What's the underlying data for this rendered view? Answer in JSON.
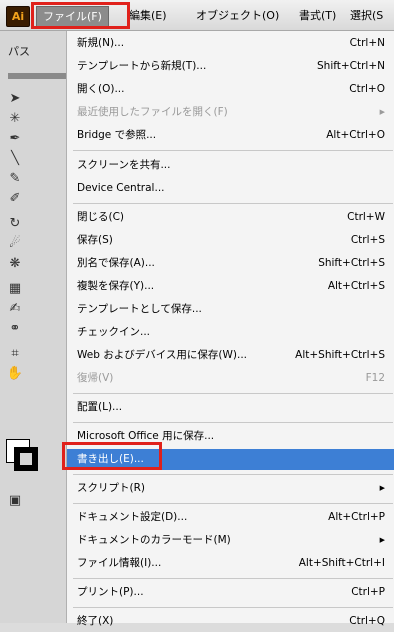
{
  "app": {
    "logo": "Ai"
  },
  "menubar": {
    "file": "ファイル(F)",
    "edit": "編集(E)",
    "object": "オブジェクト(O)",
    "type": "書式(T)",
    "select": "選択(S"
  },
  "tools_panel": {
    "tab_label": "パス"
  },
  "file_menu": {
    "items": [
      {
        "label": "新規(N)...",
        "shortcut": "Ctrl+N",
        "enabled": true
      },
      {
        "label": "テンプレートから新規(T)...",
        "shortcut": "Shift+Ctrl+N",
        "enabled": true
      },
      {
        "label": "開く(O)...",
        "shortcut": "Ctrl+O",
        "enabled": true
      },
      {
        "label": "最近使用したファイルを開く(F)",
        "shortcut": "",
        "enabled": false,
        "submenu": true
      },
      {
        "label": "Bridge で参照...",
        "shortcut": "Alt+Ctrl+O",
        "enabled": true
      },
      {
        "label": "スクリーンを共有...",
        "shortcut": "",
        "enabled": true
      },
      {
        "label": "Device Central...",
        "shortcut": "",
        "enabled": true
      },
      {
        "label": "閉じる(C)",
        "shortcut": "Ctrl+W",
        "enabled": true
      },
      {
        "label": "保存(S)",
        "shortcut": "Ctrl+S",
        "enabled": true
      },
      {
        "label": "別名で保存(A)...",
        "shortcut": "Shift+Ctrl+S",
        "enabled": true
      },
      {
        "label": "複製を保存(Y)...",
        "shortcut": "Alt+Ctrl+S",
        "enabled": true
      },
      {
        "label": "テンプレートとして保存...",
        "shortcut": "",
        "enabled": true
      },
      {
        "label": "チェックイン...",
        "shortcut": "",
        "enabled": true
      },
      {
        "label": "Web およびデバイス用に保存(W)...",
        "shortcut": "Alt+Shift+Ctrl+S",
        "enabled": true
      },
      {
        "label": "復帰(V)",
        "shortcut": "F12",
        "enabled": false
      },
      {
        "label": "配置(L)...",
        "shortcut": "",
        "enabled": true
      },
      {
        "label": "Microsoft Office 用に保存...",
        "shortcut": "",
        "enabled": true
      },
      {
        "label": "書き出し(E)...",
        "shortcut": "",
        "enabled": true,
        "highlighted": true
      },
      {
        "label": "スクリプト(R)",
        "shortcut": "",
        "enabled": true,
        "submenu": true
      },
      {
        "label": "ドキュメント設定(D)...",
        "shortcut": "Alt+Ctrl+P",
        "enabled": true
      },
      {
        "label": "ドキュメントのカラーモード(M)",
        "shortcut": "",
        "enabled": true,
        "submenu": true
      },
      {
        "label": "ファイル情報(I)...",
        "shortcut": "Alt+Shift+Ctrl+I",
        "enabled": true
      },
      {
        "label": "プリント(P)...",
        "shortcut": "Ctrl+P",
        "enabled": true
      },
      {
        "label": "終了(X)",
        "shortcut": "Ctrl+Q",
        "enabled": true
      }
    ]
  },
  "colors": {
    "highlight": "#3d7fd5",
    "callout_red": "#e0211b",
    "disabled_text": "#9a9a9a"
  }
}
